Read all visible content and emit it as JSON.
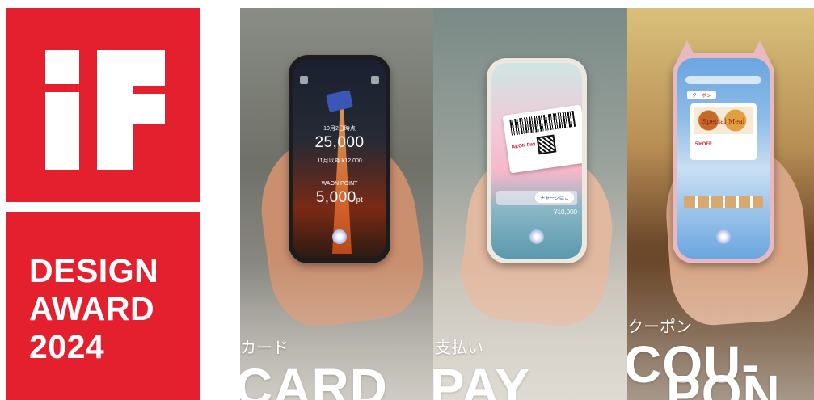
{
  "award": {
    "logo_text": "iF",
    "label": "DESIGN\nAWARD\n2024",
    "color": "#e5202e"
  },
  "panels": [
    {
      "id": "card",
      "caption_jp": "カード",
      "caption_en": "CARD",
      "screen": {
        "date_label": "10月2日時点",
        "balance": "25,000",
        "sub_line": "11月以降 ¥12,000",
        "points_label": "WAON POINT",
        "points": "5,000",
        "points_unit": "pt"
      }
    },
    {
      "id": "pay",
      "caption_jp": "支払い",
      "caption_en": "PAY",
      "screen": {
        "brand": "AEON Pay",
        "charge_button": "チャージはこ",
        "amount": "¥10,000"
      }
    },
    {
      "id": "coupon",
      "caption_jp": "クーポン",
      "caption_en_line1": "COU-",
      "caption_en_line2": "PON",
      "screen": {
        "tab": "クーポン",
        "meal_title": "Special Meal",
        "discount": "5%OFF"
      }
    }
  ]
}
